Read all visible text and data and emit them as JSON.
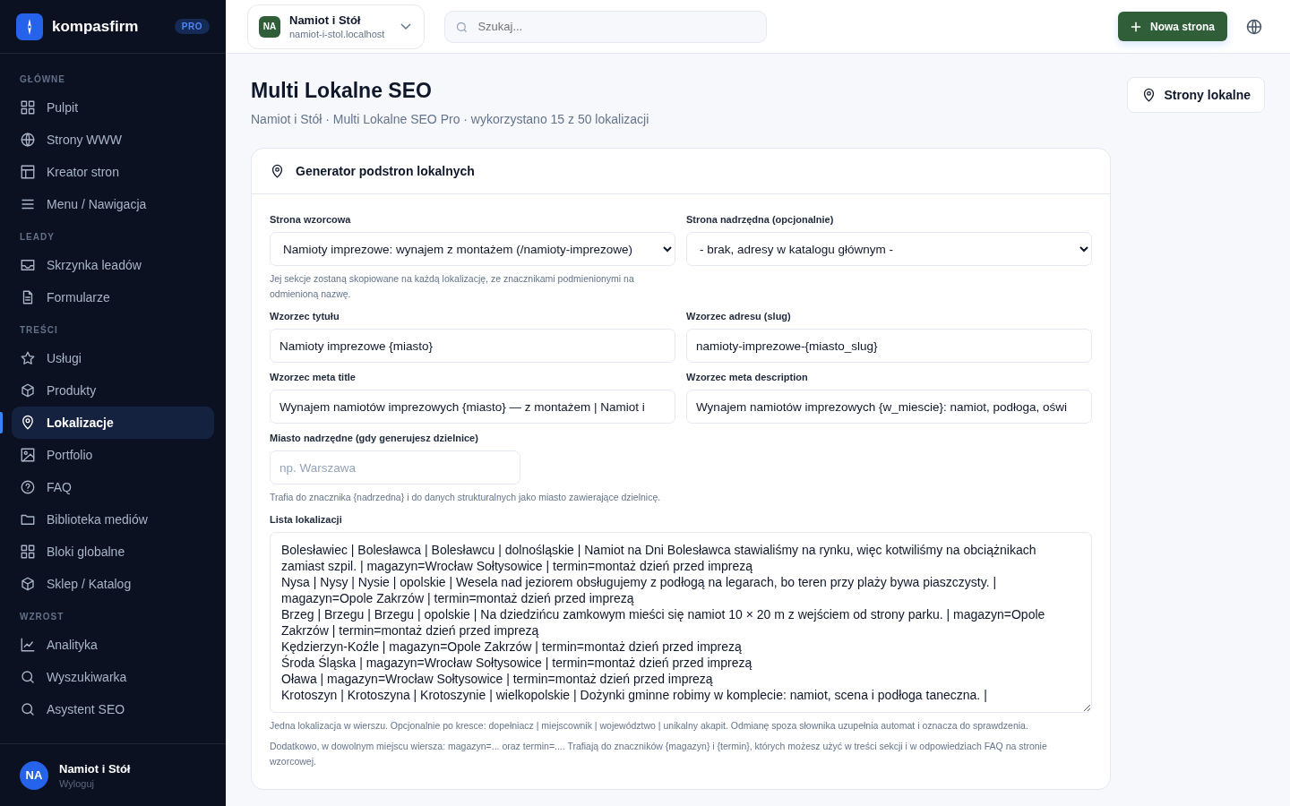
{
  "sidebar": {
    "brand": "kompasfirm",
    "badge": "PRO",
    "sections": [
      {
        "title": "GŁÓWNE",
        "items": [
          {
            "label": "Pulpit",
            "selected": false
          },
          {
            "label": "Strony WWW",
            "selected": false
          },
          {
            "label": "Kreator stron",
            "selected": false
          },
          {
            "label": "Menu / Nawigacja",
            "selected": false
          }
        ]
      },
      {
        "title": "LEADY",
        "items": [
          {
            "label": "Skrzynka leadów",
            "selected": false
          },
          {
            "label": "Formularze",
            "selected": false
          }
        ]
      },
      {
        "title": "TREŚCI",
        "items": [
          {
            "label": "Usługi",
            "selected": false
          },
          {
            "label": "Produkty",
            "selected": false
          },
          {
            "label": "Lokalizacje",
            "selected": true
          },
          {
            "label": "Portfolio",
            "selected": false
          },
          {
            "label": "FAQ",
            "selected": false
          },
          {
            "label": "Biblioteka mediów",
            "selected": false
          },
          {
            "label": "Bloki globalne",
            "selected": false
          },
          {
            "label": "Sklep / Katalog",
            "selected": false
          }
        ]
      },
      {
        "title": "WZROST",
        "items": [
          {
            "label": "Analityka",
            "selected": false
          },
          {
            "label": "Wyszukiwarka",
            "selected": false
          },
          {
            "label": "Asystent SEO",
            "selected": false
          }
        ]
      }
    ],
    "user": {
      "initials": "NA",
      "name": "Namiot i Stół",
      "action": "Wyloguj"
    }
  },
  "topbar": {
    "site": {
      "initials": "NA",
      "name": "Namiot i Stół",
      "domain": "namiot-i-stol.localhost"
    },
    "search": {
      "placeholder": "Szukaj..."
    },
    "new_button": "Nowa strona"
  },
  "page": {
    "title": "Multi Lokalne SEO",
    "subtitle": "Namiot i Stół · Multi Lokalne SEO Pro · wykorzystano 15 z 50 lokalizacji",
    "action_button": "Strony lokalne"
  },
  "card": {
    "title": "Generator podstron lokalnych",
    "fields": [
      {
        "kind": "select",
        "label": "Strona wzorcowa",
        "value": "Namioty imprezowe: wynajem z montażem (/namioty-imprezowe)",
        "help": "Jej sekcje zostaną skopiowane na każdą lokalizację, ze znacznikami podmienionymi na odmienioną nazwę."
      },
      {
        "kind": "select",
        "label": "Strona nadrzędna (opcjonalnie)",
        "value": "- brak, adresy w katalogu głównym -"
      },
      {
        "kind": "input",
        "label": "Wzorzec tytułu",
        "value": "Namioty imprezowe {miasto}"
      },
      {
        "kind": "input",
        "label": "Wzorzec adresu (slug)",
        "value": "namioty-imprezowe-{miasto_slug}"
      },
      {
        "kind": "input",
        "label": "Wzorzec meta title",
        "value": "Wynajem namiotów imprezowych {miasto} — z montażem | Namiot i"
      },
      {
        "kind": "input",
        "label": "Wzorzec meta description",
        "value": "Wynajem namiotów imprezowych {w_miescie}: namiot, podłoga, oświ"
      },
      {
        "kind": "short",
        "label": "Miasto nadrzędne (gdy generujesz dzielnice)",
        "placeholder": "np. Warszawa",
        "help": "Trafia do znacznika {nadrzedna} i do danych strukturalnych jako miasto zawierające dzielnicę."
      }
    ],
    "locations": {
      "label": "Lista lokalizacji",
      "value": "Bolesławiec | Bolesławca | Bolesławcu | dolnośląskie | Namiot na Dni Bolesławca stawialiśmy na rynku, więc kotwiliśmy na obciążnikach zamiast szpil. | magazyn=Wrocław Sołtysowice | termin=montaż dzień przed imprezą\nNysa | Nysy | Nysie | opolskie | Wesela nad jeziorem obsługujemy z podłogą na legarach, bo teren przy plaży bywa piaszczysty. | magazyn=Opole Zakrzów | termin=montaż dzień przed imprezą\nBrzeg | Brzegu | Brzegu | opolskie | Na dziedzińcu zamkowym mieści się namiot 10 × 20 m z wejściem od strony parku. | magazyn=Opole Zakrzów | termin=montaż dzień przed imprezą\nKędzierzyn-Koźle | magazyn=Opole Zakrzów | termin=montaż dzień przed imprezą\nŚroda Śląska | magazyn=Wrocław Sołtysowice | termin=montaż dzień przed imprezą\nOława | magazyn=Wrocław Sołtysowice | termin=montaż dzień przed imprezą\nKrotoszyn | Krotoszyna | Krotoszynie | wielkopolskie | Dożynki gminne robimy w komplecie: namiot, scena i podłoga taneczna. |",
      "help": [
        "Jedna lokalizacja w wierszu. Opcjonalnie po kresce: dopełniacz | miejscownik | województwo | unikalny akapit. Odmianę spoza słownika uzupełnia automat i oznacza do sprawdzenia.",
        "Dodatkowo, w dowolnym miejscu wiersza: magazyn=... oraz termin=.... Trafiają do znaczników {magazyn} i {termin}, których możesz użyć w treści sekcji i w odpowiedziach FAQ na stronie wzorcowej."
      ]
    }
  }
}
